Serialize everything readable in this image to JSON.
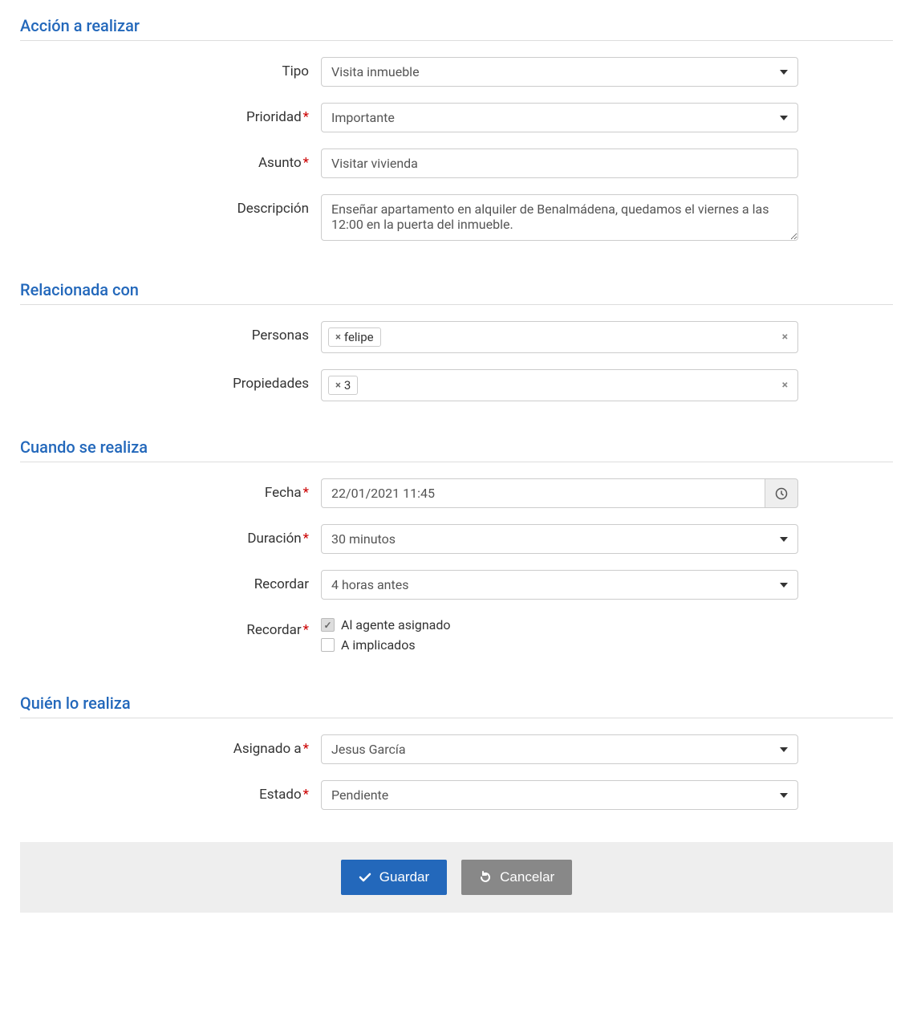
{
  "sections": {
    "accion": {
      "title": "Acción a realizar",
      "tipo": {
        "label": "Tipo",
        "value": "Visita inmueble"
      },
      "prioridad": {
        "label": "Prioridad",
        "value": "Importante"
      },
      "asunto": {
        "label": "Asunto",
        "value": "Visitar vivienda"
      },
      "descripcion": {
        "label": "Descripción",
        "value": "Enseñar apartamento en alquiler de Benalmádena, quedamos el viernes a las 12:00 en la puerta del inmueble."
      }
    },
    "relacionada": {
      "title": "Relacionada con",
      "personas": {
        "label": "Personas",
        "tag": "felipe"
      },
      "propiedades": {
        "label": "Propiedades",
        "tag": "3"
      }
    },
    "cuando": {
      "title": "Cuando se realiza",
      "fecha": {
        "label": "Fecha",
        "value": "22/01/2021 11:45"
      },
      "duracion": {
        "label": "Duración",
        "value": "30 minutos"
      },
      "recordar": {
        "label": "Recordar",
        "value": "4 horas antes"
      },
      "recordar2": {
        "label": "Recordar",
        "opt1": {
          "label": "Al agente asignado",
          "checked": true
        },
        "opt2": {
          "label": "A implicados",
          "checked": false
        }
      }
    },
    "quien": {
      "title": "Quién lo realiza",
      "asignado": {
        "label": "Asignado a",
        "value": "Jesus García"
      },
      "estado": {
        "label": "Estado",
        "value": "Pendiente"
      }
    }
  },
  "buttons": {
    "guardar": "Guardar",
    "cancelar": "Cancelar"
  }
}
